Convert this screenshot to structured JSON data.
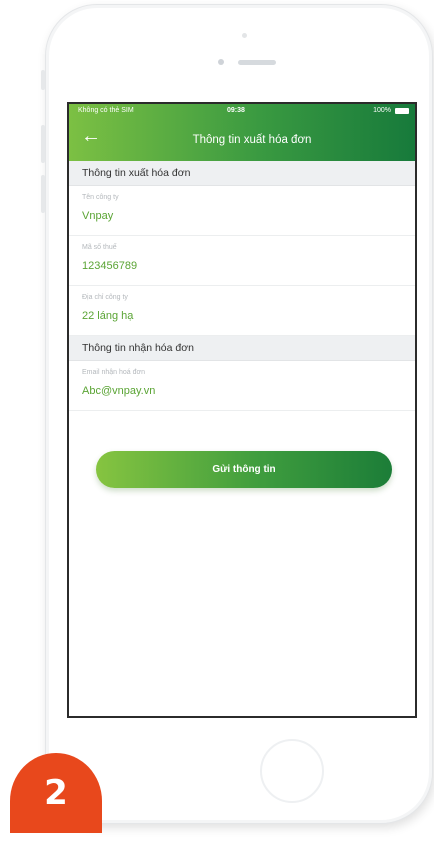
{
  "status_bar": {
    "carrier": "Không có thẻ SIM",
    "time": "09:38",
    "battery": "100%"
  },
  "header": {
    "back_icon": "arrow-left-icon",
    "title": "Thông tin xuất hóa đơn"
  },
  "invoice_section": {
    "title": "Thông tin xuất hóa đơn",
    "fields": [
      {
        "label": "Tên công ty",
        "value": "Vnpay"
      },
      {
        "label": "Mã số thuế",
        "value": "123456789"
      },
      {
        "label": "Địa chỉ công ty",
        "value": "22 láng hạ"
      }
    ]
  },
  "receive_section": {
    "title": "Thông tin nhận hóa đơn",
    "fields": [
      {
        "label": "Email nhận hoá đơn",
        "value": "Abc@vnpay.vn"
      }
    ]
  },
  "submit_button": {
    "label": "Gửi thông tin"
  },
  "step_badge": {
    "number": "2"
  },
  "colors": {
    "brand_light": "#7cc043",
    "brand_dark": "#177a3b",
    "value_text": "#5aa434",
    "badge": "#e8481c"
  }
}
